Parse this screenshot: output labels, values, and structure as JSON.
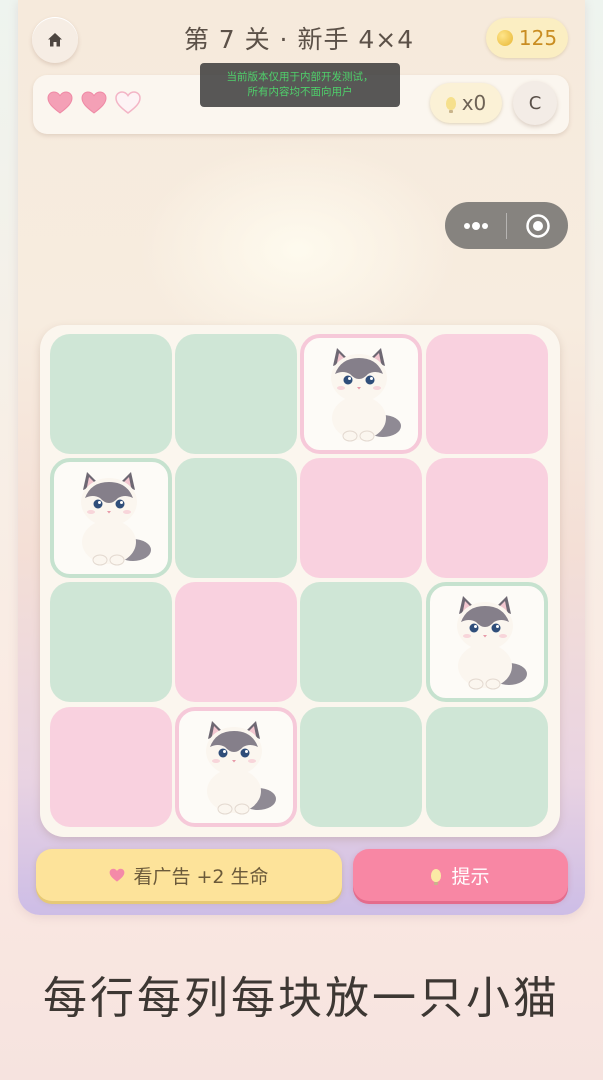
{
  "header": {
    "level_title": "第 7 关 · 新手 4×4",
    "coins": "125",
    "coin_icon": "coin-icon",
    "home_icon": "home-icon"
  },
  "status": {
    "hearts": [
      {
        "state": "full",
        "icon": "heart-full-icon"
      },
      {
        "state": "full",
        "icon": "heart-full-icon"
      },
      {
        "state": "empty",
        "icon": "heart-empty-icon"
      }
    ],
    "hint_count": "x0",
    "hint_icon": "lightbulb-icon",
    "c_button_label": "C"
  },
  "toast": {
    "line1": "当前版本仅用于内部开发测试，",
    "line2": "所有内容均不面向用户"
  },
  "mini_program_capsule": {
    "more_icon": "more-dots-icon",
    "close_icon": "target-circle-icon"
  },
  "board": {
    "size": "4x4",
    "cells": [
      [
        "green",
        "green",
        "cat-pink",
        "pink"
      ],
      [
        "cat-green",
        "green",
        "pink",
        "pink"
      ],
      [
        "green",
        "pink",
        "green",
        "cat-green"
      ],
      [
        "pink",
        "cat-pink",
        "green",
        "green"
      ]
    ],
    "cat_icon": "ragdoll-cat-icon"
  },
  "buttons": {
    "ad_label": "看广告 +2 生命",
    "hint_label": "提示"
  },
  "tagline": "每行每列每块放一只小猫",
  "colors": {
    "green_cell": "#cfe6d6",
    "pink_cell": "#f9d1df",
    "ad_button": "#fde39a",
    "hint_button": "#f887a4",
    "heart": "#f08aa8",
    "coin": "#e7b634"
  }
}
